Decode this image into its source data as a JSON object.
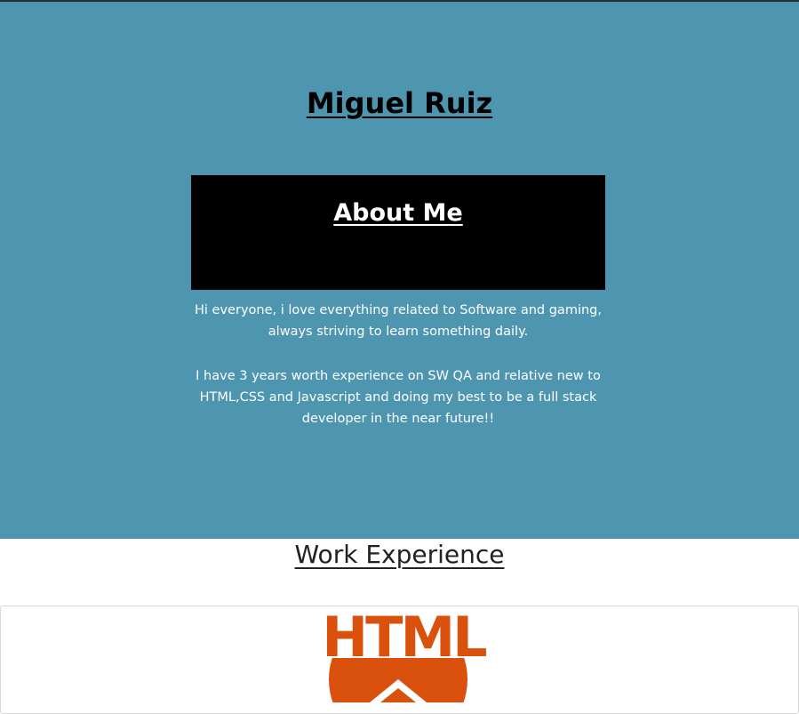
{
  "header": {
    "name": "Miguel Ruiz"
  },
  "about": {
    "title": "About Me",
    "paragraph_1": "Hi everyone, i love everything related to Software and gaming, always striving to learn something daily.",
    "paragraph_2": "I have 3 years worth experience on SW QA and relative new to HTML,CSS and Javascript and doing my best to be a full stack developer in the near future!!"
  },
  "work": {
    "title": "Work Experience",
    "card": {
      "logo_icon": "html5-logo",
      "logo_text": "HTML"
    }
  },
  "colors": {
    "hero_background": "#4e96b0",
    "about_box": "#000000",
    "html_orange": "#d9510d"
  }
}
